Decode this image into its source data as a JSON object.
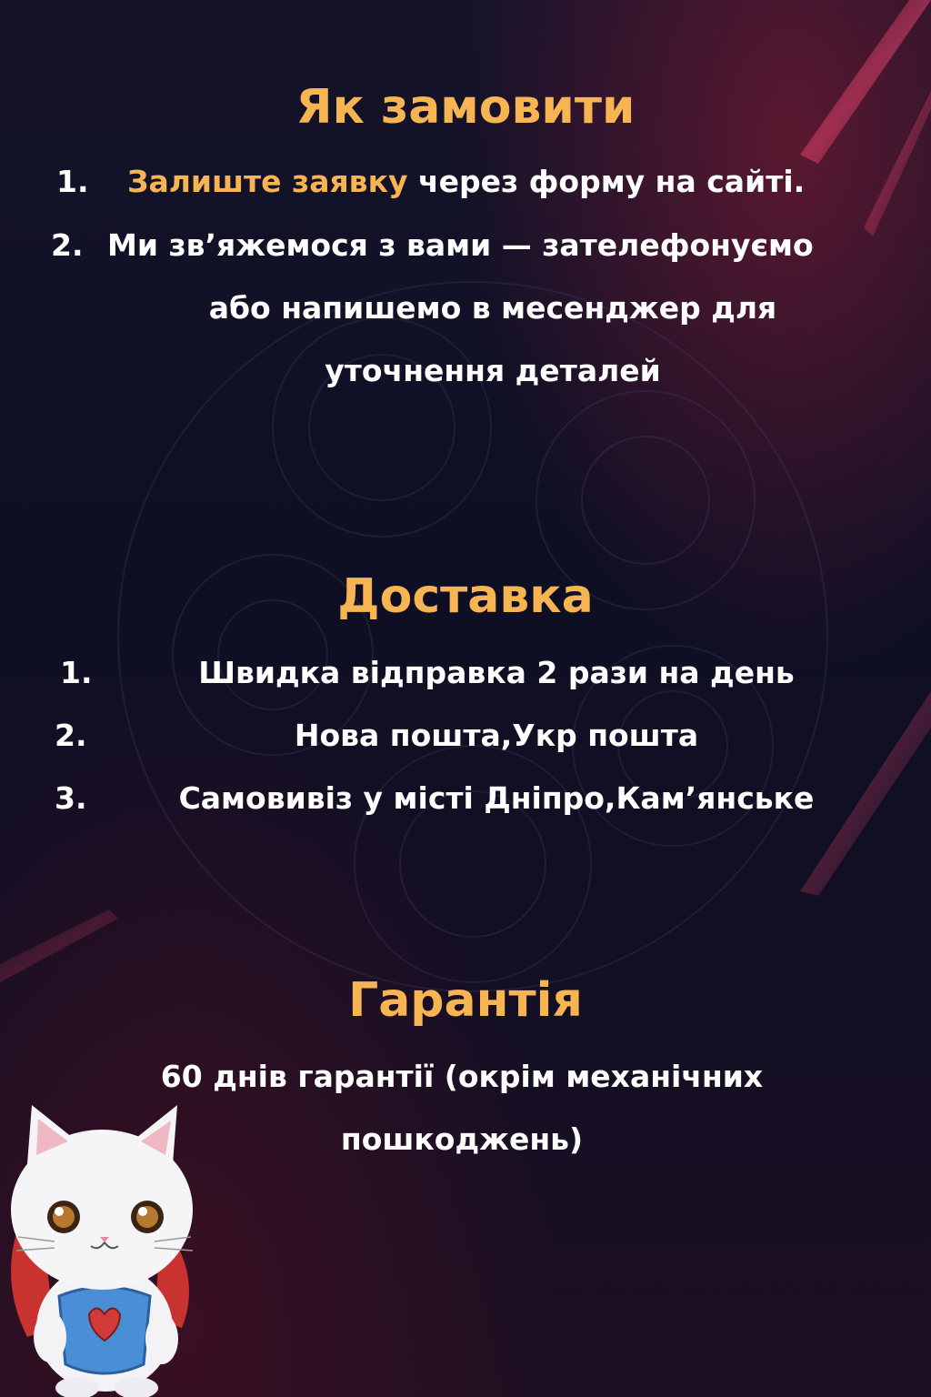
{
  "order": {
    "title": "Як замовити",
    "step1": {
      "num": "1.",
      "highlight": "Залиште заявку",
      "rest": " через форму на сайті."
    },
    "step2": {
      "num": "2.",
      "line1": "Ми зв’яжемося з вами — зателефонуємо",
      "line2": "або напишемо в месенджер для",
      "line3": "уточнення деталей"
    }
  },
  "delivery": {
    "title": "Доставка",
    "items": [
      {
        "num": "1.",
        "text": "Швидка відправка 2 рази на день"
      },
      {
        "num": "2.",
        "text": "Нова пошта,Укр пошта"
      },
      {
        "num": "3.",
        "text": "Самовивіз у місті Дніпро,Кам’янське"
      }
    ]
  },
  "warranty": {
    "title": "Гарантія",
    "line1": "60 днів гарантії (окрім механічних",
    "line2": "пошкоджень)"
  },
  "colors": {
    "accent": "#f7b452",
    "text": "#ffffff",
    "background": "#10102a"
  },
  "decor": {
    "mascot": "cat-superhero-icon"
  }
}
